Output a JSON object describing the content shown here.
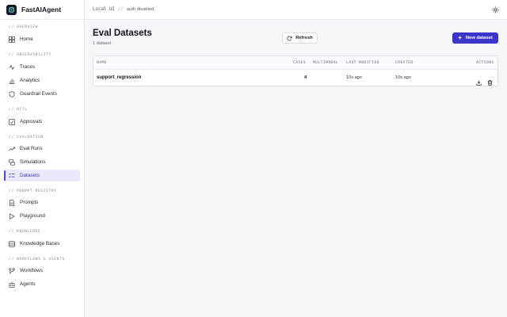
{
  "brand": {
    "name": "FastAIAgent"
  },
  "topbar": {
    "env": "Local UI",
    "separator": "//",
    "auth": "auth disabled"
  },
  "sidebar": {
    "sections": [
      {
        "label": "// OVERVIEW"
      },
      {
        "label": "// OBSERVABILITY"
      },
      {
        "label": "// HITL"
      },
      {
        "label": "// EVALUATION"
      },
      {
        "label": "// PROMPT REGISTRY"
      },
      {
        "label": "// KNOWLEDGE"
      },
      {
        "label": "// WORKFLOWS & AGENTS"
      }
    ],
    "items": [
      {
        "label": "Home",
        "icon": "grid-icon"
      },
      {
        "label": "Traces",
        "icon": "activity-icon"
      },
      {
        "label": "Analytics",
        "icon": "bar-chart-icon"
      },
      {
        "label": "Guardrail Events",
        "icon": "shield-icon"
      },
      {
        "label": "Approvals",
        "icon": "check-square-icon"
      },
      {
        "label": "Eval Runs",
        "icon": "trending-up-icon"
      },
      {
        "label": "Simulations",
        "icon": "chat-bubbles-icon"
      },
      {
        "label": "Datasets",
        "icon": "list-check-icon",
        "active": true
      },
      {
        "label": "Prompts",
        "icon": "file-icon"
      },
      {
        "label": "Playground",
        "icon": "play-icon"
      },
      {
        "label": "Knowledge Bases",
        "icon": "database-icon"
      },
      {
        "label": "Workflows",
        "icon": "workflow-icon"
      },
      {
        "label": "Agents",
        "icon": "bot-icon"
      }
    ]
  },
  "main": {
    "title": "Eval Datasets",
    "subtitle": "1 dataset",
    "refresh_label": "Refresh",
    "new_label": "New dataset",
    "new_plus": "+",
    "accent": "#3b36c9"
  },
  "table": {
    "headers": {
      "name": "NAME",
      "cases": "CASES",
      "multimodal": "MULTIMODAL",
      "last_modified": "LAST MODIFIED",
      "created": "CREATED",
      "actions": "ACTIONS"
    },
    "rows": [
      {
        "name": "support_regression",
        "cases": "4",
        "multimodal": "",
        "last_modified": "10s ago",
        "created": "10s ago"
      }
    ]
  }
}
